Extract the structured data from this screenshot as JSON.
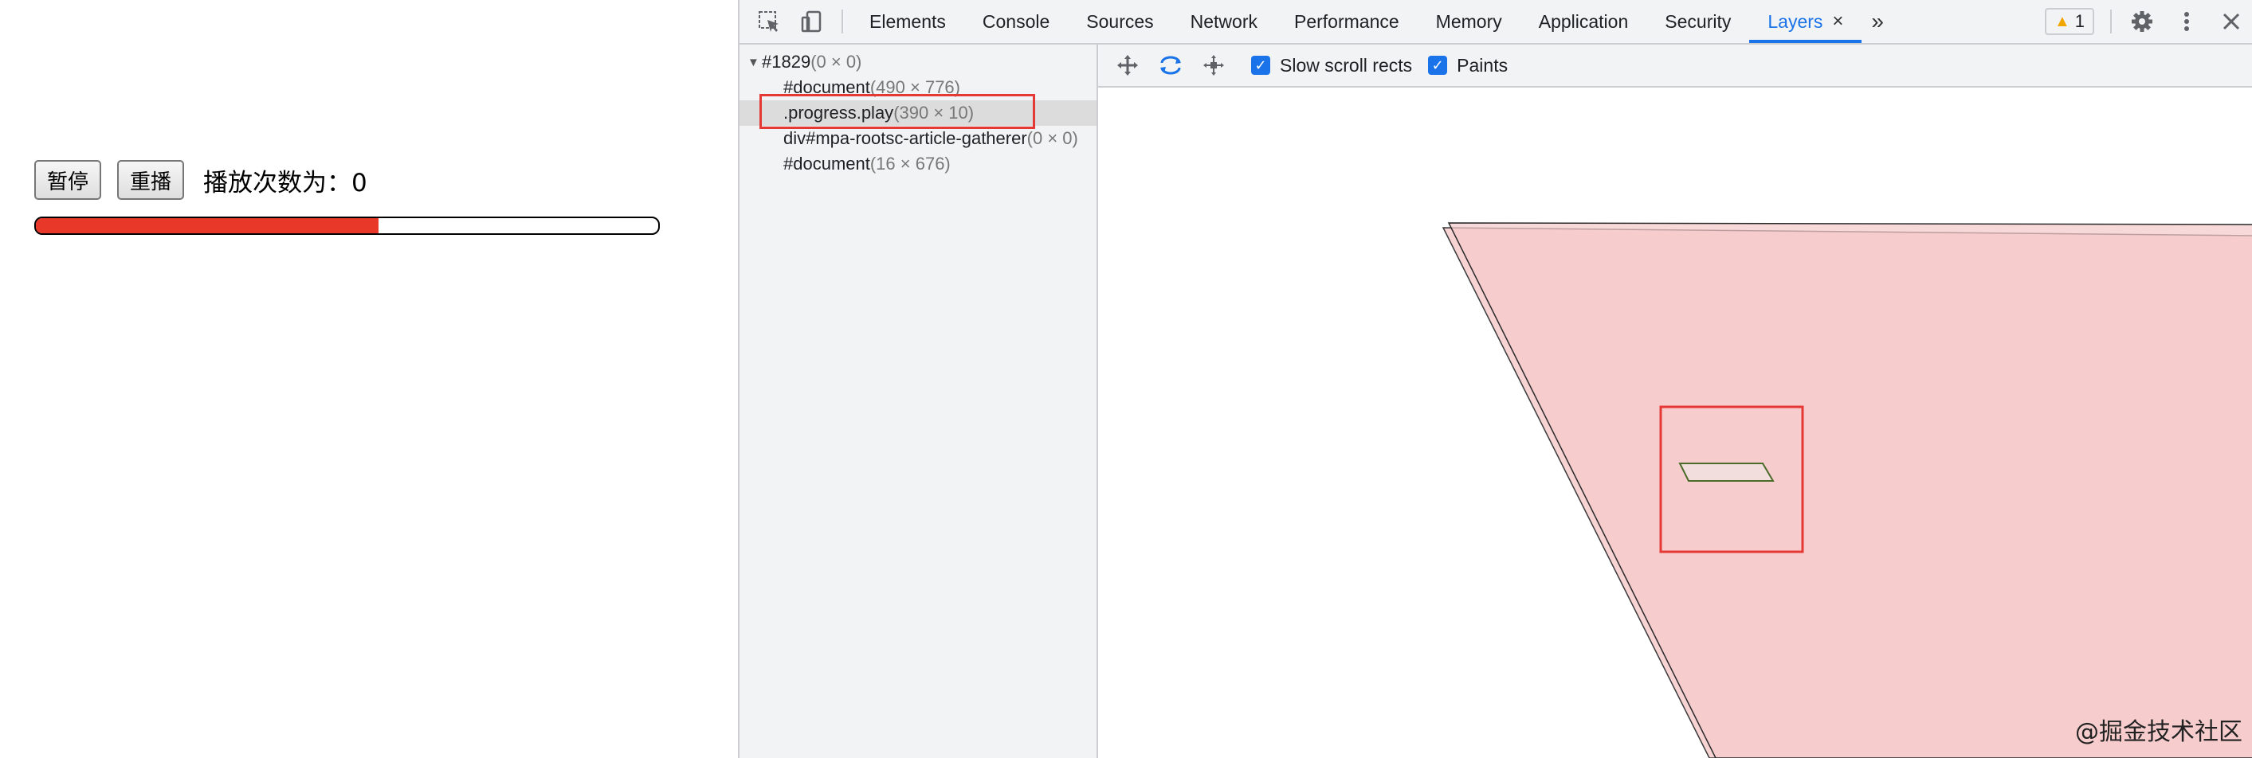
{
  "page": {
    "pause_label": "暂停",
    "replay_label": "重播",
    "play_count_text": "播放次数为：0",
    "progress_fraction": 0.55,
    "progress_color": "#e8382a"
  },
  "devtools": {
    "tabs": [
      "Elements",
      "Console",
      "Sources",
      "Network",
      "Performance",
      "Memory",
      "Application",
      "Security"
    ],
    "active_tab": "Layers",
    "tab_close": "×",
    "more_tabs": "»",
    "warning_count": "1",
    "layer_tree": [
      {
        "name": "#1829",
        "size": "(0 × 0)"
      },
      {
        "name": "#document",
        "size": "(490 × 776)"
      },
      {
        "name": ".progress.play",
        "size": "(390 × 10)"
      },
      {
        "name": "div#mpa-rootsc-article-gatherer",
        "size": "(0 × 0)"
      },
      {
        "name": "#document",
        "size": "(16 × 676)"
      }
    ],
    "slow_scroll_label": "Slow scroll rects",
    "paints_label": "Paints",
    "accent_color": "#1a73e8",
    "layer_color": "#f7d3d4"
  },
  "watermark": "@掘金技术社区"
}
